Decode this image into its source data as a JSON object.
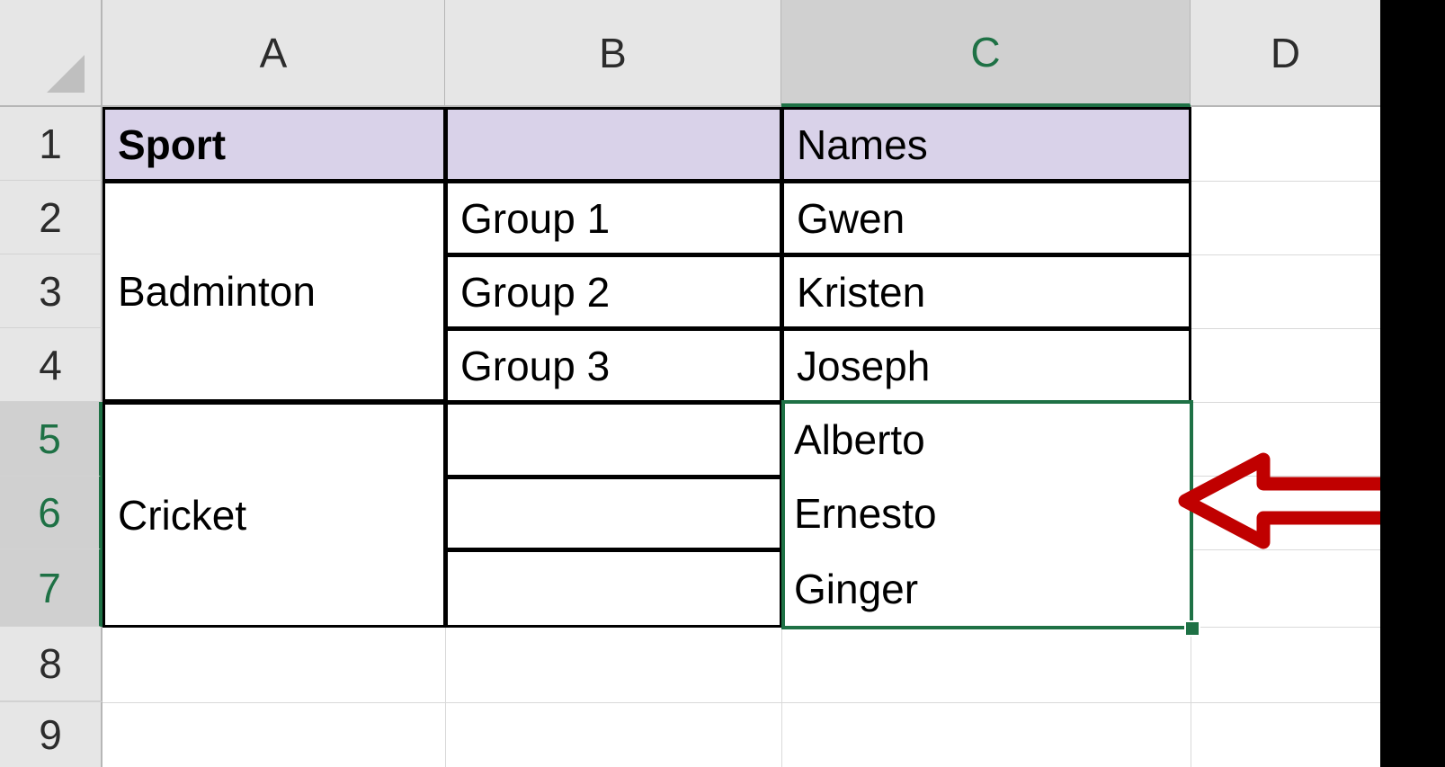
{
  "app": {
    "type": "spreadsheet",
    "selected_range": "C5:C7"
  },
  "grid": {
    "column_headers": [
      {
        "label": "A",
        "selected": false
      },
      {
        "label": "B",
        "selected": false
      },
      {
        "label": "C",
        "selected": true
      },
      {
        "label": "D",
        "selected": false
      }
    ],
    "row_headers": [
      {
        "label": "1",
        "selected": false
      },
      {
        "label": "2",
        "selected": false
      },
      {
        "label": "3",
        "selected": false
      },
      {
        "label": "4",
        "selected": false
      },
      {
        "label": "5",
        "selected": true
      },
      {
        "label": "6",
        "selected": true
      },
      {
        "label": "7",
        "selected": true
      },
      {
        "label": "8",
        "selected": false
      },
      {
        "label": "9",
        "selected": false
      }
    ],
    "select_all_icon": "select-all-corner-triangle"
  },
  "cells": {
    "a1": "Sport",
    "b1": "",
    "c1": "Names",
    "a2_merged": "Badminton",
    "b2": "Group 1",
    "c2": "Gwen",
    "b3": "Group 2",
    "c3": "Kristen",
    "b4": "Group 3",
    "c4": "Joseph",
    "a5_merged": "Cricket",
    "b5": "",
    "c5": "Alberto",
    "b6": "",
    "c6": "Ernesto",
    "b7": "",
    "c7": "Ginger"
  },
  "annotation": {
    "arrow_icon": "left-arrow-annotation",
    "color": "#C00000",
    "direction": "left"
  },
  "colors": {
    "header_fill": "#D9D2E9",
    "selection_green": "#1E7145",
    "header_gray": "#E6E6E6",
    "selected_header_gray": "#D0D0D0",
    "gridline": "#D9D9D9",
    "cell_border": "#000000",
    "annotation_red": "#C00000"
  }
}
